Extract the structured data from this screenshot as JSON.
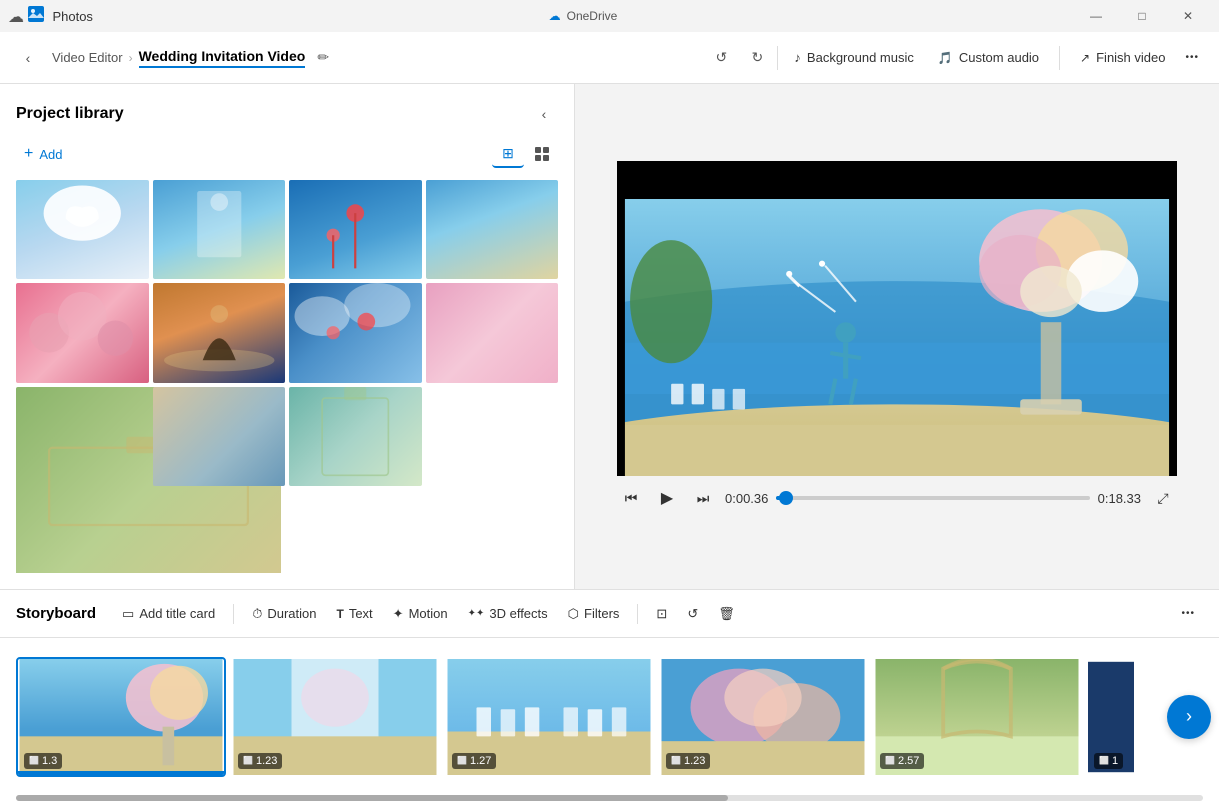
{
  "app": {
    "title": "Photos",
    "onedrive_label": "OneDrive"
  },
  "titlebar": {
    "minimize": "—",
    "maximize": "□",
    "close": "✕"
  },
  "navbar": {
    "back_label": "‹",
    "breadcrumb_home": "Video Editor",
    "breadcrumb_separator": "›",
    "project_title": "Wedding Invitation Video",
    "edit_icon": "✏",
    "undo_label": "Undo",
    "redo_label": "Redo",
    "background_music_label": "Background music",
    "custom_audio_label": "Custom audio",
    "finish_video_label": "Finish video",
    "more_label": "•••"
  },
  "project_library": {
    "title": "Project library",
    "add_label": "Add",
    "collapse_label": "‹",
    "view_large_label": "⊞",
    "view_small_label": "⊟"
  },
  "media_items": [
    {
      "id": 1,
      "type": "sky"
    },
    {
      "id": 2,
      "type": "beach"
    },
    {
      "id": 3,
      "type": "blue_balloons"
    },
    {
      "id": 4,
      "type": "venue"
    },
    {
      "id": 5,
      "type": "roses"
    },
    {
      "id": 6,
      "type": "sunset_couple"
    },
    {
      "id": 7,
      "type": "blue_clouds"
    },
    {
      "id": 8,
      "type": "petals"
    },
    {
      "id": 9,
      "type": "arch_wide"
    },
    {
      "id": 10,
      "type": "table_setting"
    },
    {
      "id": 11,
      "type": "arch_narrow"
    }
  ],
  "video_player": {
    "time_current": "0:00.36",
    "time_total": "0:18.33"
  },
  "storyboard": {
    "title": "Storyboard",
    "add_title_card_label": "Add title card",
    "duration_label": "Duration",
    "text_label": "Text",
    "motion_label": "Motion",
    "effects_3d_label": "3D effects",
    "filters_label": "Filters",
    "more_label": "•••",
    "items": [
      {
        "id": 1,
        "duration": "1.3",
        "type": "flowers_beach"
      },
      {
        "id": 2,
        "duration": "1.23",
        "type": "curtain_beach"
      },
      {
        "id": 3,
        "duration": "1.27",
        "type": "ceremony_beach"
      },
      {
        "id": 4,
        "duration": "1.23",
        "type": "flowers_close"
      },
      {
        "id": 5,
        "duration": "2.57",
        "type": "arch_garden"
      },
      {
        "id": 6,
        "duration": "1",
        "type": "dark_blue"
      }
    ]
  }
}
